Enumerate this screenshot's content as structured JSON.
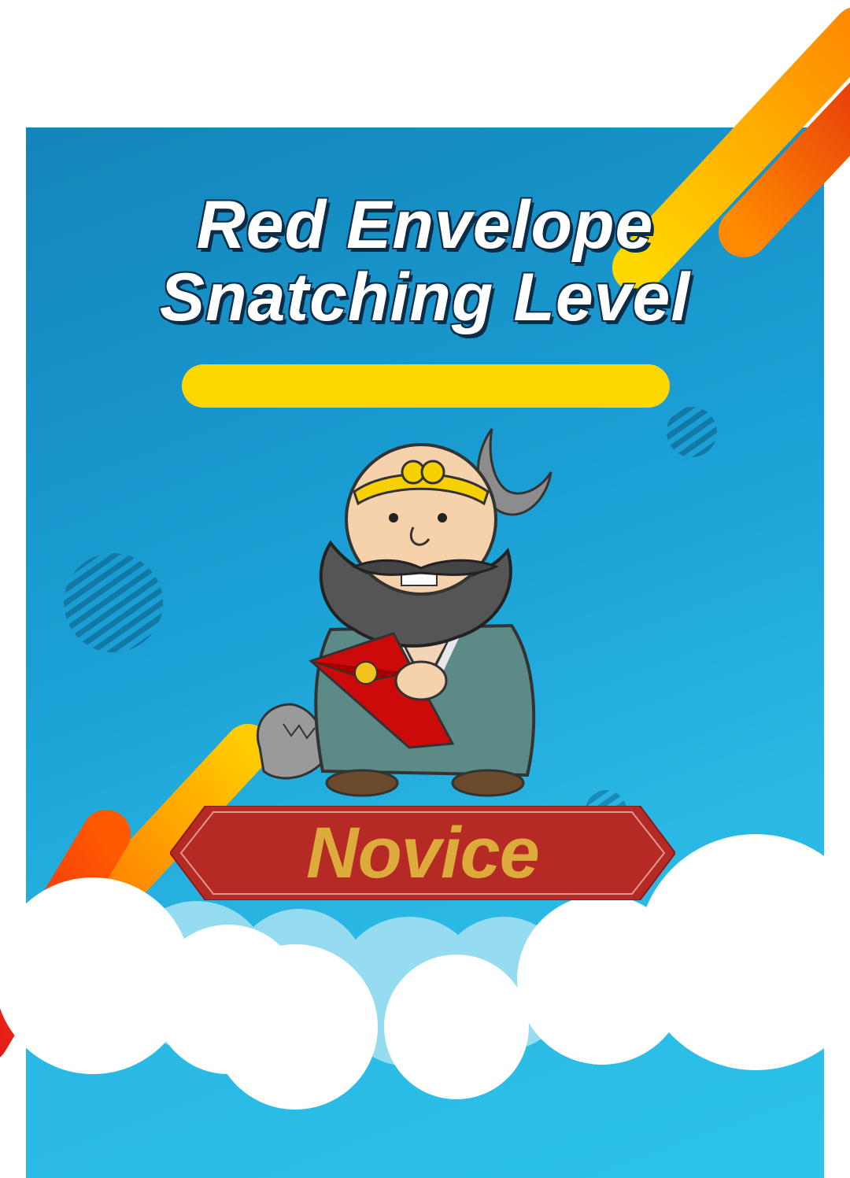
{
  "poster": {
    "title_line1": "Red Envelope",
    "title_line2": "Snatching Level",
    "level_label": "Novice"
  },
  "colors": {
    "background_top": "#1484bb",
    "background_bottom": "#2cc3ea",
    "accent_yellow": "#fdd800",
    "accent_orange": "#ff8a00",
    "banner_red": "#b52a25",
    "banner_text": "#dcab3c",
    "cloud": "#ffffff"
  },
  "icons": {
    "character": "monk-character-holding-red-envelope",
    "stripes": "striped-circle-decoration",
    "clouds": "cloud-decoration"
  }
}
